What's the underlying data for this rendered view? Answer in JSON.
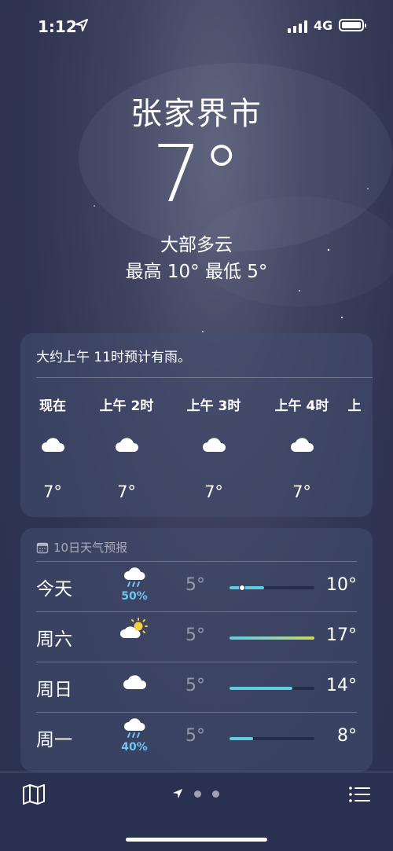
{
  "status_bar": {
    "time": "1:12",
    "network": "4G"
  },
  "location": {
    "city": "张家界市",
    "temperature": "7°",
    "condition": "大部多云",
    "high_low": "最高 10°  最低 5°"
  },
  "hourly": {
    "summary": "大约上午 11时预计有雨。",
    "hours": [
      {
        "label": "现在",
        "icon": "cloud-icon",
        "temp": "7°"
      },
      {
        "label": "上午 2时",
        "icon": "cloud-icon",
        "temp": "7°"
      },
      {
        "label": "上午 3时",
        "icon": "cloud-icon",
        "temp": "7°"
      },
      {
        "label": "上午 4时",
        "icon": "cloud-icon",
        "temp": "7°"
      },
      {
        "label": "上",
        "icon": "",
        "temp": ""
      }
    ]
  },
  "forecast": {
    "title": "10日天气预报",
    "days": [
      {
        "day": "今天",
        "icon": "cloud-rain-icon",
        "precip": "50%",
        "low": "5°",
        "high": "10°"
      },
      {
        "day": "周六",
        "icon": "partly-sunny-icon",
        "precip": "",
        "low": "5°",
        "high": "17°"
      },
      {
        "day": "周日",
        "icon": "cloud-icon",
        "precip": "",
        "low": "5°",
        "high": "14°"
      },
      {
        "day": "周一",
        "icon": "cloud-rain-icon",
        "precip": "40%",
        "low": "5°",
        "high": "8°"
      }
    ]
  },
  "colors": {
    "background": "#2f3552",
    "card": "#464e70",
    "precip": "#6cc6f2",
    "temp_bar_cool": "#5fcde0",
    "temp_bar_warm": "#c8d95a"
  },
  "bottom_bar": {
    "icons": [
      "map-icon",
      "location-arrow-icon",
      "page-dot-icon",
      "list-icon"
    ],
    "page_count": 3,
    "current_page": 1
  }
}
